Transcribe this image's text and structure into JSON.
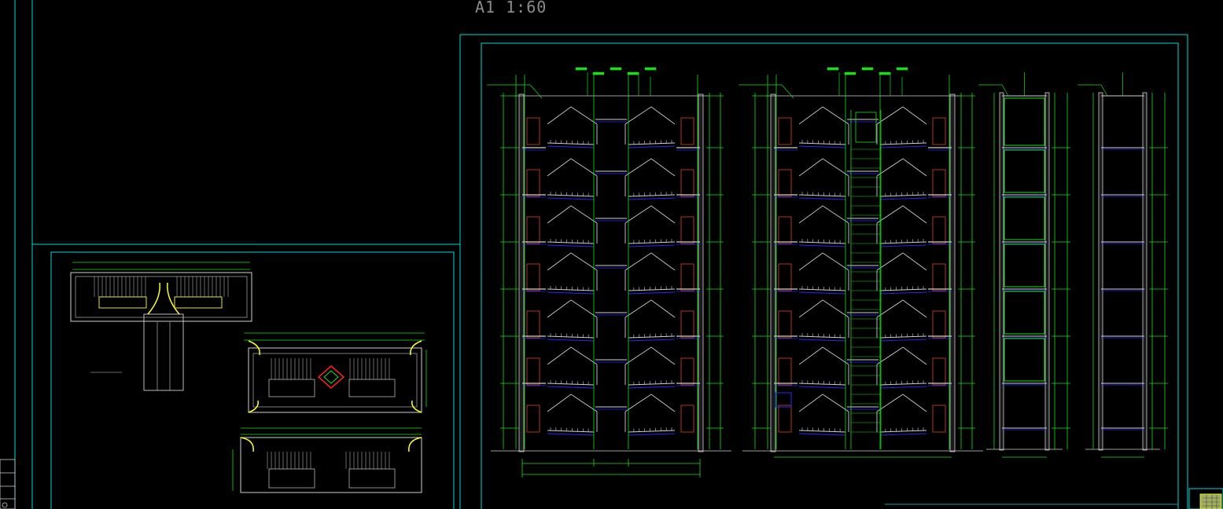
{
  "sheet": {
    "scale_label": "A1 1:60"
  },
  "colors": {
    "background": "#000000",
    "frame": "#00d8d8",
    "wall": "#cfcfcf",
    "structure_green": "#18e018",
    "landing_blue": "#2828ff",
    "door_red": "#c83c1e",
    "accent_yellow": "#ffff28",
    "accent_red": "#ff2020"
  },
  "icons": [
    "zoom-navigator-icon"
  ]
}
